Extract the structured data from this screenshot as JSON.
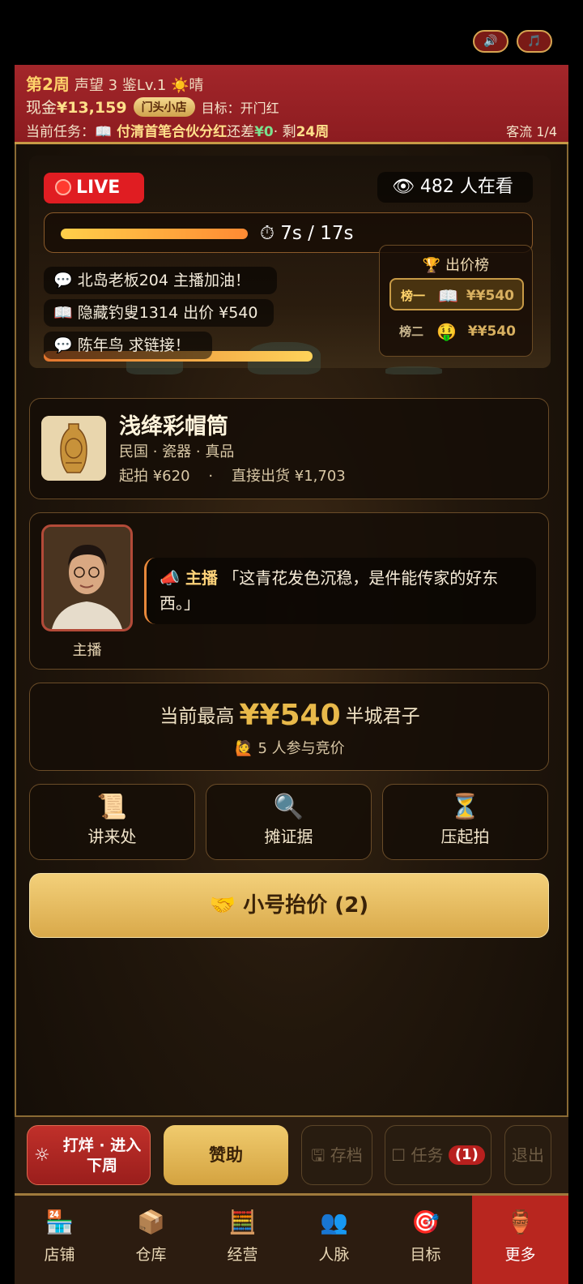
{
  "header": {
    "week": "第2周",
    "stats": "声望 3 鉴Lv.1 ☀️晴",
    "cash_label": "现金",
    "cash": "¥13,159",
    "shop_badge": "门头小店",
    "goal": "目标：开门红",
    "task_prefix": "当前任务：",
    "task_name": "📖 付清首笔合伙分红",
    "task_gap_label": "还差",
    "task_gap": "¥0",
    "task_left_label": "· 剩",
    "task_left": "24周",
    "customer_flow": "客流 1/4",
    "sound_icon": "🔊",
    "music_icon": "🎵"
  },
  "live": {
    "badge": "LIVE",
    "viewers": "👁 482 人在看",
    "timer_fraction": 0.41,
    "timer_text": "⏱ 7s / 17s",
    "chats": [
      "💬 北岛老板204 主播加油！",
      "📖 隐藏钓叟1314 出价 ¥540",
      "💬 陈年鸟 求链接！"
    ],
    "heat_fraction": 0.55,
    "board": {
      "title": "🏆 出价榜",
      "rows": [
        {
          "rank": "榜一",
          "icon": "📖",
          "price": "¥¥540"
        },
        {
          "rank": "榜二",
          "icon": "🤑",
          "price": "¥¥540"
        }
      ]
    }
  },
  "item": {
    "name": "浅绛彩帽筒",
    "meta": "民国 · 瓷器 · 真品",
    "price_line": "起拍 ¥620    ·    直接出货 ¥1,703"
  },
  "host": {
    "label": "主播",
    "speaker": "📣 主播",
    "quote": "「这青花发色沉稳，是件能传家的好东西。」"
  },
  "bid": {
    "prefix": "当前最高",
    "amount": "¥¥540",
    "bidder": "半城君子",
    "count": "🙋 5 人参与竞价"
  },
  "actions": [
    {
      "icon": "📜",
      "label": "讲来处"
    },
    {
      "icon": "🔍",
      "label": "摊证据"
    },
    {
      "icon": "⏳",
      "label": "压起拍"
    }
  ],
  "raise_button": "🤝 小号抬价 (2)",
  "bottom": {
    "next_icon": "☼",
    "next_label": "打烊 · 进入下周",
    "sponsor": "赞助",
    "save": "🖫 存档",
    "task": "☐ 任务",
    "task_count": "(1)",
    "exit": "退出"
  },
  "tabs": [
    {
      "icon": "🏪",
      "label": "店铺"
    },
    {
      "icon": "📦",
      "label": "仓库"
    },
    {
      "icon": "🧮",
      "label": "经营"
    },
    {
      "icon": "👥",
      "label": "人脉"
    },
    {
      "icon": "🎯",
      "label": "目标"
    },
    {
      "icon": "🏺",
      "label": "更多"
    }
  ],
  "colors": {
    "header_red": "#a3262a",
    "gold": "#d9a94a",
    "active_tab": "#b8261f"
  }
}
